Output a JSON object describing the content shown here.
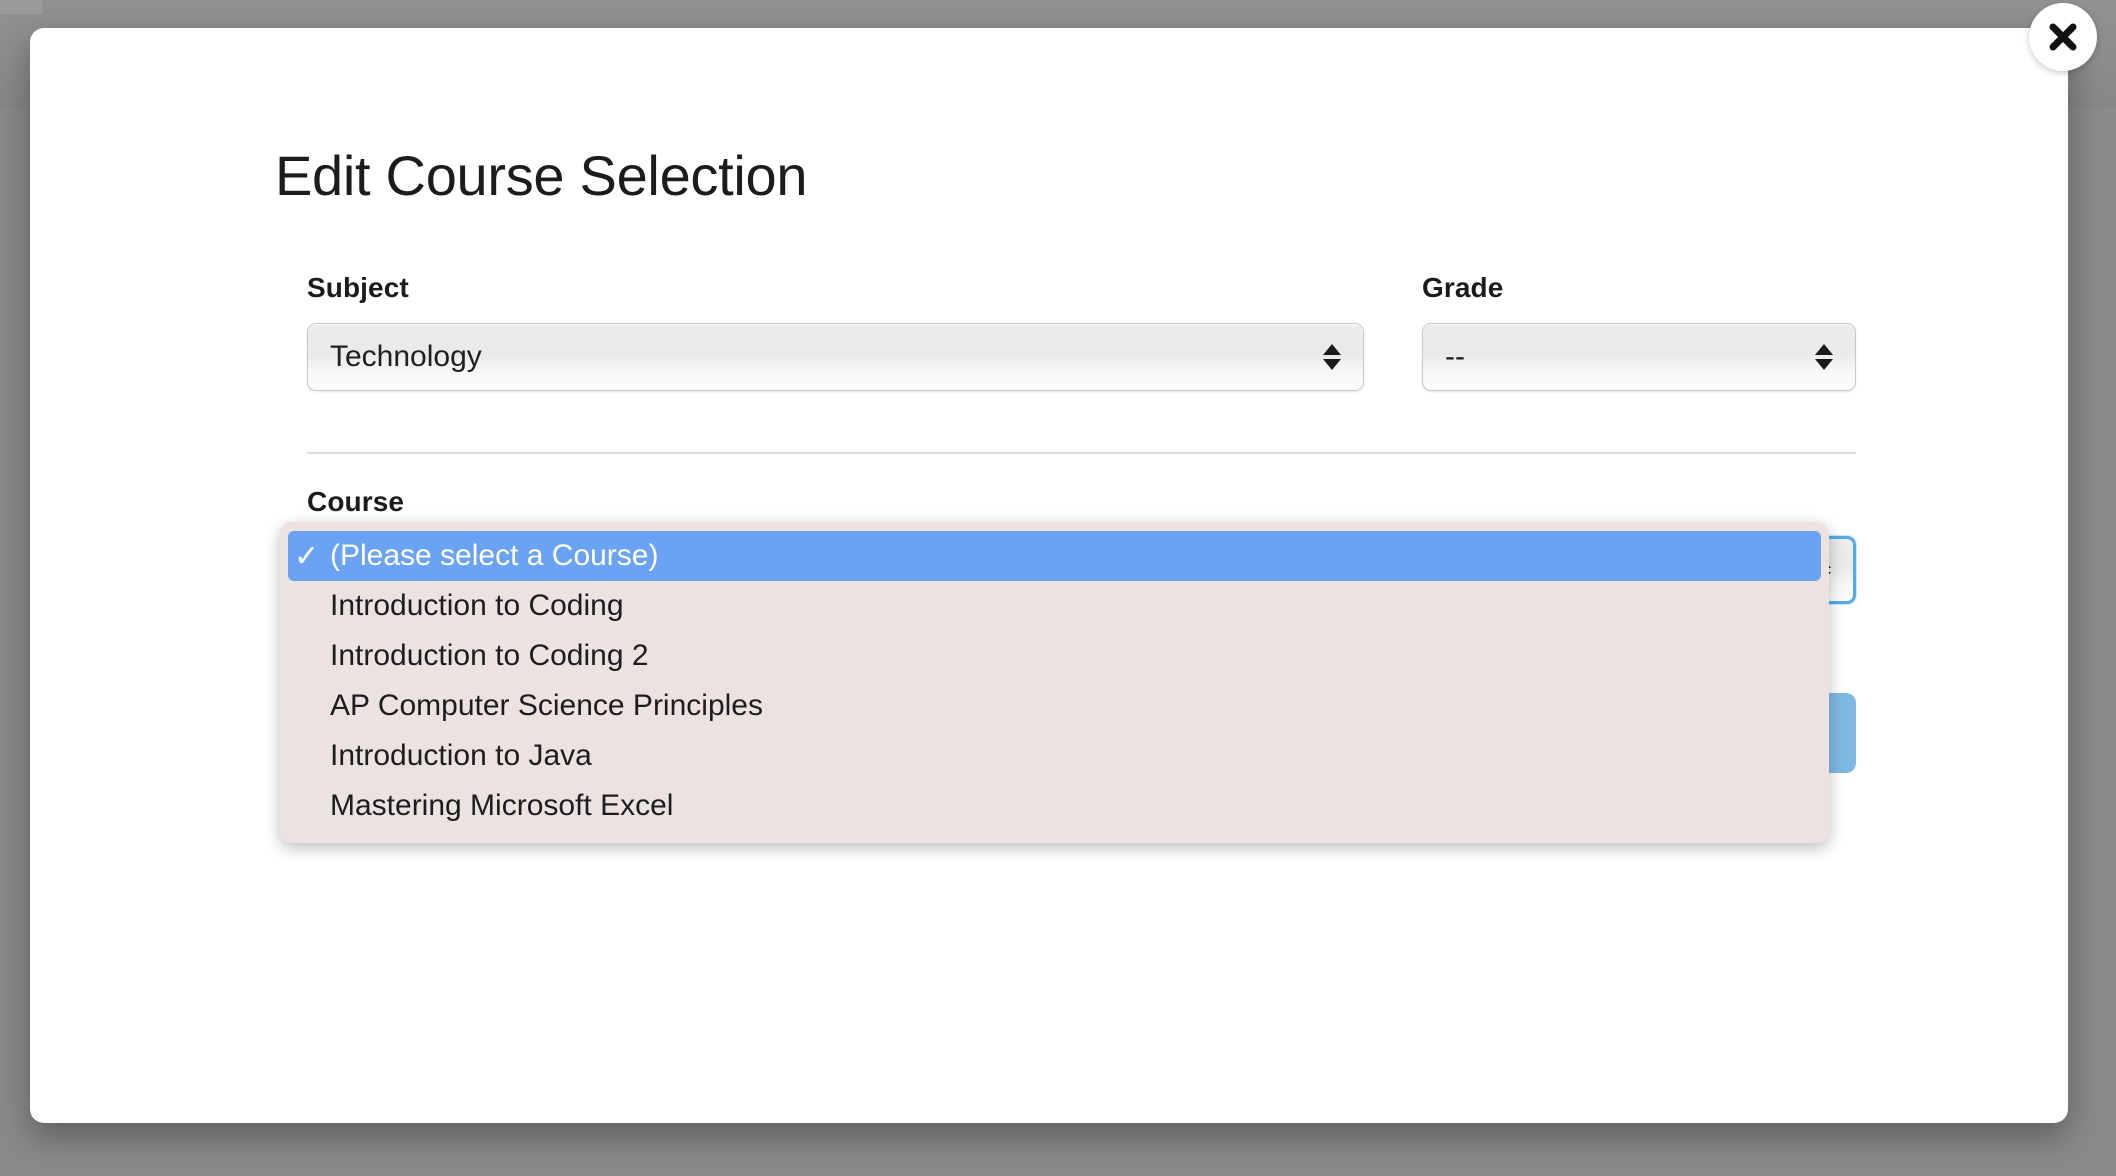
{
  "modal": {
    "title": "Edit Course Selection",
    "close_icon": "close-x-icon"
  },
  "fields": {
    "subject": {
      "label": "Subject",
      "value": "Technology",
      "stepper_icon": "up-down-stepper-icon"
    },
    "grade": {
      "label": "Grade",
      "value": "--",
      "stepper_icon": "up-down-stepper-icon"
    },
    "course": {
      "label": "Course",
      "value": "(Please select a Course)",
      "stepper_icon": "up-down-stepper-icon"
    }
  },
  "course_dropdown": {
    "open": true,
    "check_glyph": "✓",
    "selected_index": 0,
    "options": [
      "(Please select a Course)",
      "Introduction to Coding",
      "Introduction to Coding 2",
      "AP Computer Science Principles",
      "Introduction to Java",
      "Mastering Microsoft Excel"
    ]
  },
  "actions": {
    "save_label": ""
  },
  "colors": {
    "highlight_blue": "#6aa3f4",
    "focus_ring_blue": "#53aae6",
    "button_blue": "#7fb9e2",
    "dropdown_bg": "#ece2e2",
    "backdrop_gray": "#8a8a8a"
  }
}
